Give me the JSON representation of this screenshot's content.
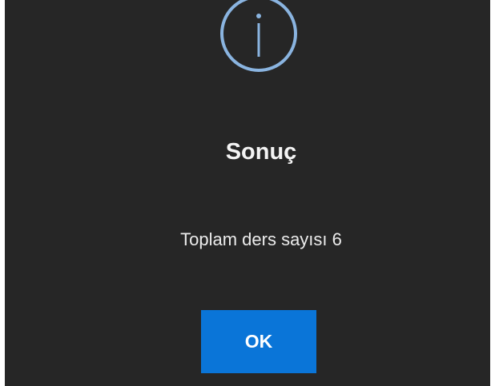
{
  "dialog": {
    "icon": "info-icon",
    "title": "Sonuç",
    "message": "Toplam ders sayısı 6",
    "ok_label": "OK"
  },
  "colors": {
    "background": "#262626",
    "accent": "#0a75d8",
    "icon_stroke": "#8ab4e0",
    "text": "#ffffff"
  }
}
